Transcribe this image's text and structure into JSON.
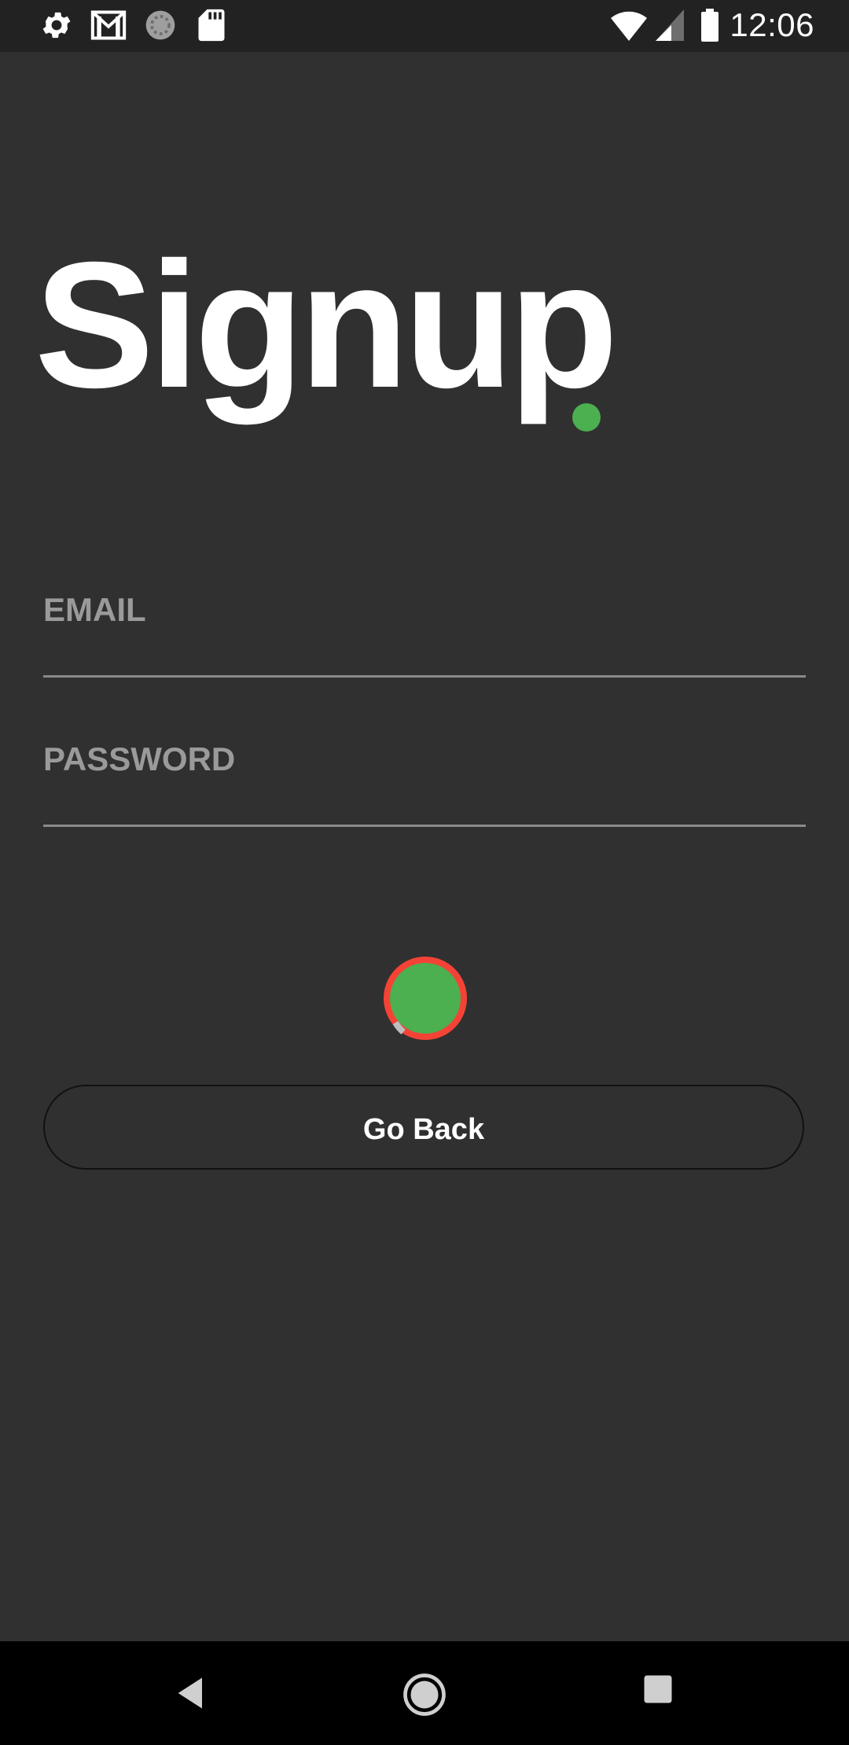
{
  "status_bar": {
    "time": "12:06",
    "left_icons": [
      "settings-icon",
      "gmail-icon",
      "sync-icon",
      "sd-card-icon"
    ],
    "right_icons": [
      "wifi-icon",
      "signal-icon",
      "battery-icon"
    ]
  },
  "screen": {
    "title": "Signup",
    "email_label": "EMAIL",
    "password_label": "PASSWORD",
    "go_back_label": "Go Back"
  },
  "colors": {
    "background": "#303030",
    "accent_green": "#4caf50",
    "spinner_red": "#f44336",
    "text_white": "#ffffff",
    "label_gray": "#9a9a9a"
  },
  "nav_bar": {
    "buttons": [
      "back-icon",
      "home-icon",
      "recents-icon"
    ]
  }
}
